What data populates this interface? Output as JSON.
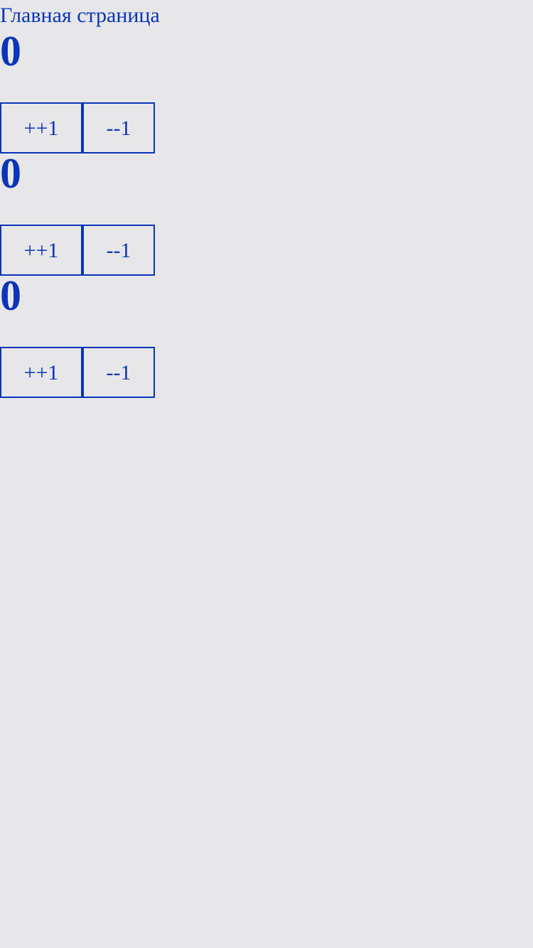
{
  "header": {
    "title": "Главная страница"
  },
  "counters": [
    {
      "value": "0",
      "increment_label": "++1",
      "decrement_label": "--1"
    },
    {
      "value": "0",
      "increment_label": "++1",
      "decrement_label": "--1"
    },
    {
      "value": "0",
      "increment_label": "++1",
      "decrement_label": "--1"
    }
  ],
  "colors": {
    "background": "#e7e7e9",
    "accent": "#0a35b8"
  }
}
